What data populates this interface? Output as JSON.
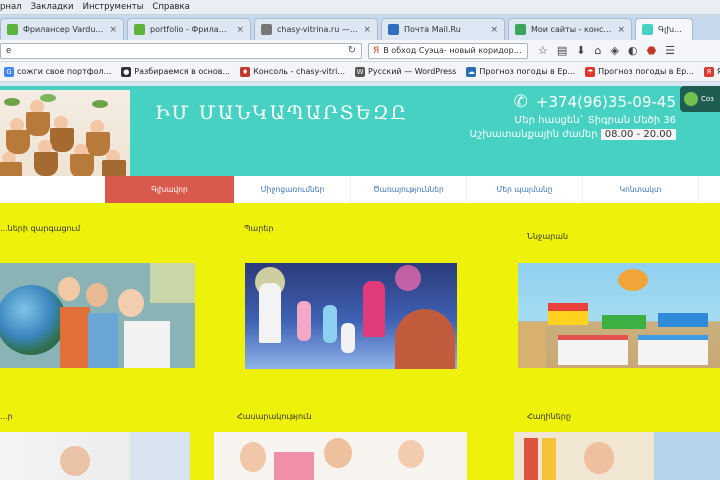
{
  "browser": {
    "menu": [
      "рнал",
      "Закладки",
      "Инструменты",
      "Справка"
    ],
    "tabs": [
      {
        "title": "Фрилансер Varduhi Gr...",
        "color": "#5db33b",
        "active": false
      },
      {
        "title": "portfolio - Фрилансер...",
        "color": "#5db33b",
        "active": false
      },
      {
        "title": "chasy-vitrina.ru — Ещё...",
        "color": "#777777",
        "active": false
      },
      {
        "title": "Почта Mail.Ru",
        "color": "#2f6fbf",
        "active": false
      },
      {
        "title": "Мои сайты - констру...",
        "color": "#3ba55c",
        "active": false
      },
      {
        "title": "Գլխավ...",
        "color": "#46d1c3",
        "active": true
      }
    ],
    "url": "e",
    "search_text": "В обход Суэца- новый коридор Р...",
    "bookmarks": [
      {
        "label": "сожги свое портфол...",
        "color": "#4285f4",
        "glyph": "G"
      },
      {
        "label": "Разбираемся в основ...",
        "color": "#333333",
        "glyph": "●"
      },
      {
        "label": "Консоль - chasy-vitri...",
        "color": "#c0392b",
        "glyph": "♦"
      },
      {
        "label": "Русский — WordPress",
        "color": "#555555",
        "glyph": "W"
      },
      {
        "label": "Прогноз погоды в Ер...",
        "color": "#2d6db5",
        "glyph": "☁"
      },
      {
        "label": "Прогноз погоды в Ер...",
        "color": "#d9382b",
        "glyph": "☂"
      },
      {
        "label": "Яндекс.Перево...",
        "color": "#d9382b",
        "glyph": "Я"
      }
    ]
  },
  "site": {
    "title": "ԻՄ ՄԱՆԿԱՊԱՐՏԵԶԸ",
    "phone": "+374(96)35-09-45",
    "address": "Մեր հասցեն` Տիգրան Մեծի 36",
    "hours_label": "Աշխատանքային ժամեր",
    "hours_value": "08.00 - 20.00",
    "widget_label": "Соз",
    "menu": [
      "Գլխավոր",
      "Միջոցառումներ",
      "Ծառայություններ",
      "Մեր պայմանը",
      "Կոնտակտ"
    ],
    "sections": {
      "s1": "...ների զարգացում",
      "s2": "Պարեր",
      "s3": "Ննջարան",
      "s4": "...ր",
      "s5": "Հասարակություն",
      "s6": "Հաղիները"
    }
  }
}
